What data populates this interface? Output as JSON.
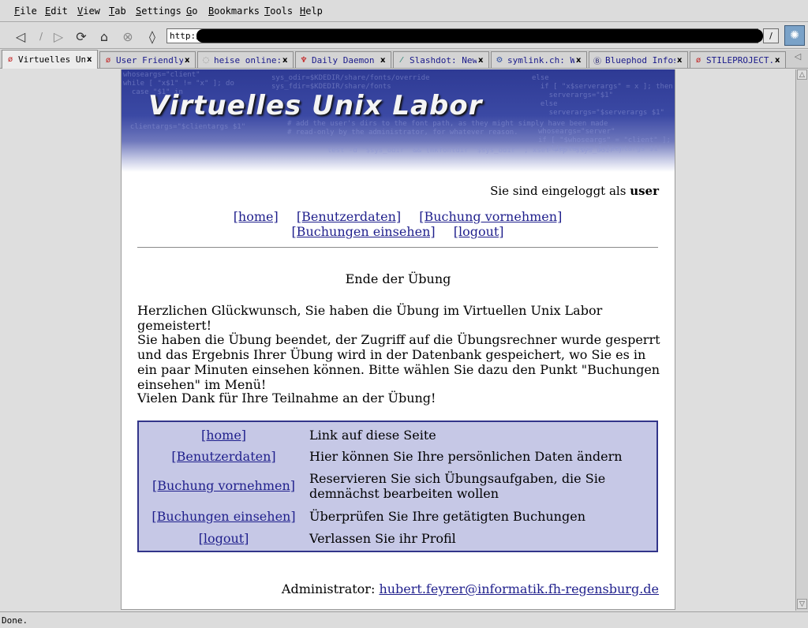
{
  "menu": [
    {
      "label": "File",
      "mnemonic": "F"
    },
    {
      "label": "Edit",
      "mnemonic": "E"
    },
    {
      "label": "View",
      "mnemonic": "V"
    },
    {
      "label": "Tab",
      "mnemonic": "T"
    },
    {
      "label": "Settings",
      "mnemonic": "S"
    },
    {
      "label": "Go",
      "mnemonic": "G"
    },
    {
      "label": "Bookmarks",
      "mnemonic": "B"
    },
    {
      "label": "Tools",
      "mnemonic": "T"
    },
    {
      "label": "Help",
      "mnemonic": "H"
    }
  ],
  "navbar": {
    "url_prefix": "http:/"
  },
  "tabs": [
    {
      "label": "Virtuelles Uni",
      "icon": "gecko-icon",
      "active": true
    },
    {
      "label": "User Friendly",
      "icon": "gecko-icon",
      "active": false
    },
    {
      "label": "heise online:",
      "icon": "loading-icon",
      "active": false
    },
    {
      "label": "Daily Daemon N",
      "icon": "daemon-icon",
      "active": false
    },
    {
      "label": "Slashdot: News",
      "icon": "slashdot-icon",
      "active": false
    },
    {
      "label": "symlink.ch: Wi",
      "icon": "symlink-icon",
      "active": false
    },
    {
      "label": "Bluephod Infos",
      "icon": "bluephod-icon",
      "active": false
    },
    {
      "label": "STILEPROJECT.C",
      "icon": "gecko-icon",
      "active": false
    }
  ],
  "status": "Done.",
  "page": {
    "banner_title": "Virtuelles Unix Labor",
    "login_prefix": "Sie sind eingeloggt als",
    "login_user": "user",
    "nav": [
      {
        "label": "[home]"
      },
      {
        "label": "[Benutzerdaten]"
      },
      {
        "label": "[Buchung vornehmen]"
      },
      {
        "label": "[Buchungen einsehen]"
      },
      {
        "label": "[logout]"
      }
    ],
    "heading": "Ende der Übung",
    "para1": "Herzlichen Glückwunsch, Sie haben die Übung im Virtuellen Unix Labor gemeistert!",
    "para2": "Sie haben die Übung beendet, der Zugriff auf die Übungsrechner wurde gesperrt und das Ergebnis Ihrer Übung wird in der Datenbank gespeichert, wo Sie es in ein paar Minuten einsehen können. Bitte wählen Sie dazu den Punkt \"Buchungen einsehen\" im Menü!",
    "para3": "Vielen Dank für Ihre Teilnahme an der Übung!",
    "table": [
      {
        "link": "[home]",
        "desc": "Link auf diese Seite"
      },
      {
        "link": "[Benutzerdaten]",
        "desc": "Hier können Sie Ihre persönlichen Daten ändern"
      },
      {
        "link": "[Buchung vornehmen]",
        "desc": "Reservieren Sie sich Übungsaufgaben, die Sie demnächst bearbeiten wollen"
      },
      {
        "link": "[Buchungen einsehen]",
        "desc": "Überprüfen Sie Ihre getätigten Buchungen"
      },
      {
        "link": "[logout]",
        "desc": "Verlassen Sie ihr Profil"
      }
    ],
    "admin_label": "Administrator:",
    "admin_email": "hubert.feyrer@informatik.fh-regensburg.de"
  }
}
